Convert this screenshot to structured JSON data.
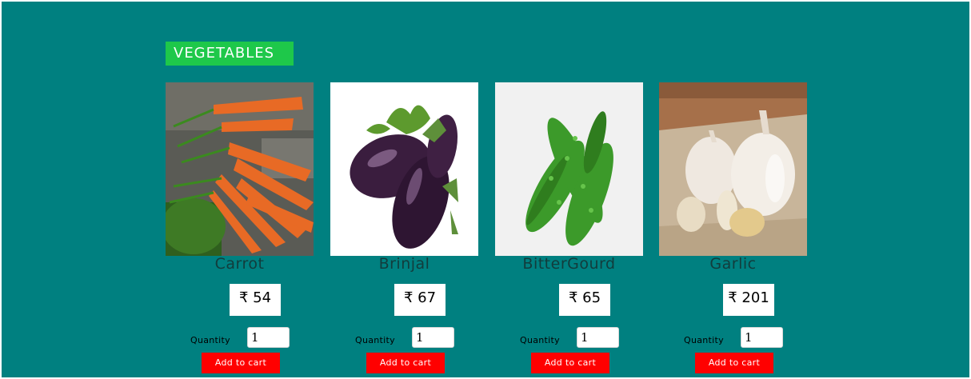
{
  "section": {
    "title": "VEGETABLES"
  },
  "products": [
    {
      "name": "Carrot",
      "price": "₹ 54",
      "quantity_label": "Quantity",
      "quantity": "1",
      "button_label": "Add to cart",
      "image": "carrot-photo"
    },
    {
      "name": "Brinjal",
      "price": "₹ 67",
      "quantity_label": "Quantity",
      "quantity": "1",
      "button_label": "Add to cart",
      "image": "brinjal-photo"
    },
    {
      "name": "BitterGourd",
      "price": "₹ 65",
      "quantity_label": "Quantity",
      "quantity": "1",
      "button_label": "Add to cart",
      "image": "bittergourd-photo"
    },
    {
      "name": "Garlic",
      "price": "₹ 201",
      "quantity_label": "Quantity",
      "quantity": "1",
      "button_label": "Add to cart",
      "image": "garlic-photo"
    }
  ],
  "colors": {
    "background": "#008080",
    "section_tag": "#1ec84a",
    "button": "#ff0000"
  }
}
